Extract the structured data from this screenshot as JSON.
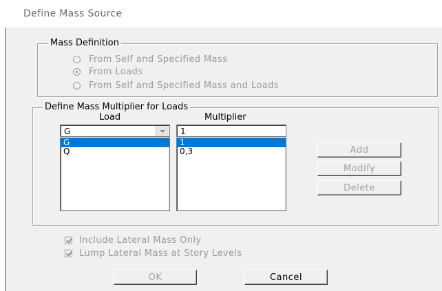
{
  "window": {
    "title": "Define Mass Source"
  },
  "mass_definition": {
    "title": "Mass Definition",
    "options": [
      {
        "label": "From Self and Specified Mass",
        "selected": false
      },
      {
        "label": "From Loads",
        "selected": true
      },
      {
        "label": "From Self and Specified Mass and Loads",
        "selected": false
      }
    ]
  },
  "multiplier_group": {
    "title": "Define Mass Multiplier for Loads",
    "load_header": "Load",
    "multiplier_header": "Multiplier",
    "load_combo_value": "G",
    "multiplier_input_value": "1",
    "load_list": [
      "G",
      "Q"
    ],
    "multiplier_list": [
      "1",
      "0,3"
    ],
    "selected_index": 0,
    "add_label": "Add",
    "modify_label": "Modify",
    "delete_label": "Delete"
  },
  "options": {
    "lateral_only_label": "Include Lateral Mass Only",
    "lateral_only_checked": true,
    "lump_label": "Lump Lateral Mass at Story Levels",
    "lump_checked": true
  },
  "footer": {
    "ok_label": "OK",
    "cancel_label": "Cancel"
  }
}
